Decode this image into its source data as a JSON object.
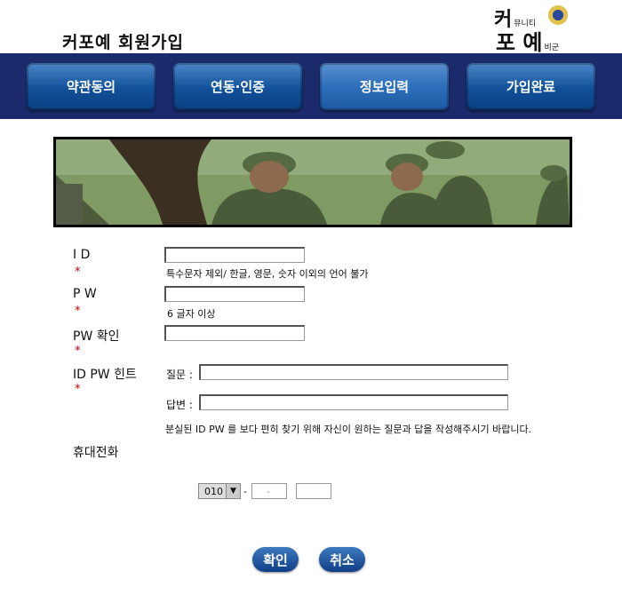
{
  "header": {
    "title": "커포예 회원가입",
    "logo": {
      "line1": "커",
      "line1_small": "뮤니티",
      "line2": "포 예",
      "line2_small": "비군"
    }
  },
  "nav": {
    "tabs": [
      {
        "label": "약관동의",
        "active": false
      },
      {
        "label": "연동·인증",
        "active": false
      },
      {
        "label": "정보입력",
        "active": true
      },
      {
        "label": "가입완료",
        "active": false
      }
    ]
  },
  "form": {
    "id": {
      "label": "I D",
      "required": "*",
      "hint": "특수문자 제외/ 한글, 영문, 숫자 이외의 언어 불가",
      "value": ""
    },
    "pw": {
      "label": "P W",
      "required": "*",
      "hint": "6 글자 이상",
      "value": ""
    },
    "pw_confirm": {
      "label": "PW 확인",
      "required": "*",
      "value": ""
    },
    "hint_section": {
      "label": "ID PW 힌트",
      "required": "*",
      "question_label": "질문 :",
      "answer_label": "답변 :",
      "question_value": "",
      "answer_value": "",
      "note": "분실된 ID PW 를 보다 편히 찾기 위해 자신이 원하는 질문과 답을 작성해주시기 바랍니다."
    },
    "phone": {
      "label": "휴대전화",
      "prefix": "010",
      "sep1": "-",
      "sep2": "-",
      "mid_value": "",
      "last_value": ""
    }
  },
  "buttons": {
    "confirm": "확인",
    "cancel": "취소"
  },
  "colors": {
    "nav_bg": "#1b2a6b",
    "tab": "#11509a",
    "required": "#cc0000"
  }
}
